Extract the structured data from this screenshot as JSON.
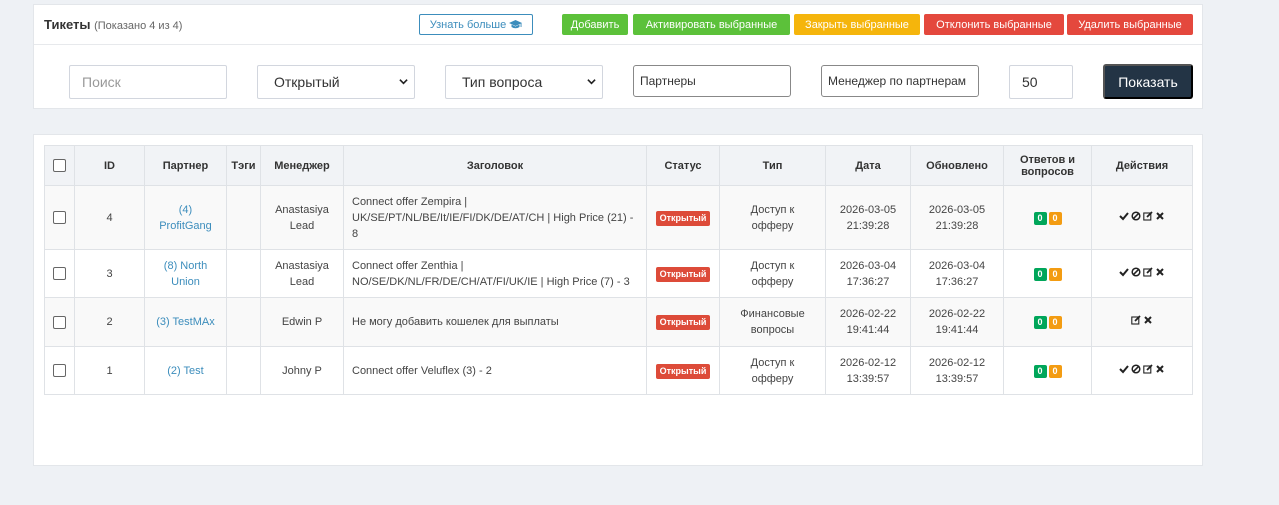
{
  "header": {
    "title": "Тикеты",
    "count": "(Показано 4 из 4)",
    "learn_more": "Узнать больше",
    "actions": {
      "add": "Добавить",
      "activate": "Активировать выбранные",
      "close": "Закрыть выбранные",
      "reject": "Отклонить выбранные",
      "delete": "Удалить выбранные"
    }
  },
  "filters": {
    "search_placeholder": "Поиск",
    "status_value": "Открытый",
    "type_value": "Тип вопроса",
    "partners_placeholder": "Партнеры",
    "manager_placeholder": "Менеджер по партнерам",
    "limit_value": "50",
    "show_button": "Показать"
  },
  "table": {
    "columns": {
      "id": "ID",
      "partner": "Партнер",
      "tags": "Тэги",
      "manager": "Менеджер",
      "title": "Заголовок",
      "status": "Статус",
      "type": "Тип",
      "date": "Дата",
      "updated": "Обновлено",
      "replies_line1": "Ответов и",
      "replies_line2": "вопросов",
      "actions": "Действия"
    },
    "rows": [
      {
        "id": "4",
        "partner_line1": "(4)",
        "partner_line2": "ProfitGang",
        "tags": "",
        "manager_line1": "Anastasiya",
        "manager_line2": "Lead",
        "title": "Connect offer Zempira | UK/SE/PT/NL/BE/It/IE/FI/DK/DE/AT/CH | High Price (21) - 8",
        "status": "Открытый",
        "type_line1": "Доступ к",
        "type_line2": "офферу",
        "date_line1": "2026-03-05",
        "date_line2": "21:39:28",
        "updated_line1": "2026-03-05",
        "updated_line2": "21:39:28",
        "answers": "0",
        "questions": "0"
      },
      {
        "id": "3",
        "partner_line1": "(8) North",
        "partner_line2": "Union",
        "tags": "",
        "manager_line1": "Anastasiya",
        "manager_line2": "Lead",
        "title": "Connect offer Zenthia | NO/SE/DK/NL/FR/DE/CH/AT/FI/UK/IE | High Price (7) - 3",
        "status": "Открытый",
        "type_line1": "Доступ к",
        "type_line2": "офферу",
        "date_line1": "2026-03-04",
        "date_line2": "17:36:27",
        "updated_line1": "2026-03-04",
        "updated_line2": "17:36:27",
        "answers": "0",
        "questions": "0"
      },
      {
        "id": "2",
        "partner_line1": "(3) TestMAx",
        "partner_line2": "",
        "tags": "",
        "manager_line1": "Edwin P",
        "manager_line2": "",
        "title": "Не могу добавить кошелек для выплаты",
        "status": "Открытый",
        "type_line1": "Финансовые",
        "type_line2": "вопросы",
        "date_line1": "2026-02-22",
        "date_line2": "19:41:44",
        "updated_line1": "2026-02-22",
        "updated_line2": "19:41:44",
        "answers": "0",
        "questions": "0"
      },
      {
        "id": "1",
        "partner_line1": "(2) Test",
        "partner_line2": "",
        "tags": "",
        "manager_line1": "Johny P",
        "manager_line2": "",
        "title": "Connect offer Veluflex (3) - 2",
        "status": "Открытый",
        "type_line1": "Доступ к",
        "type_line2": "офферу",
        "date_line1": "2026-02-12",
        "date_line2": "13:39:57",
        "updated_line1": "2026-02-12",
        "updated_line2": "13:39:57",
        "answers": "0",
        "questions": "0"
      }
    ]
  },
  "colors": {
    "green": "#5cc13a",
    "orange": "#f5b50c",
    "red": "#e4483d",
    "dark": "#233445",
    "link": "#3c8dbc"
  }
}
